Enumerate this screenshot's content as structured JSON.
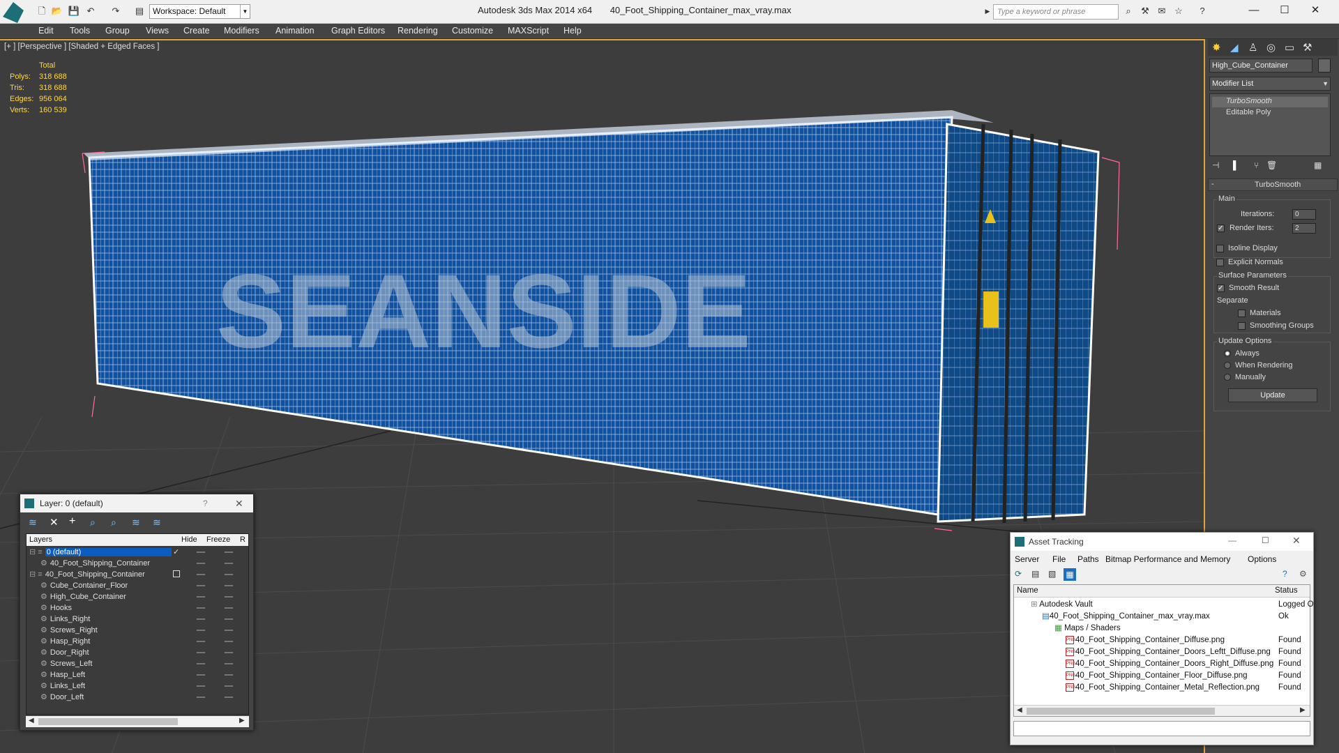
{
  "titlebar": {
    "app": "Autodesk 3ds Max  2014 x64",
    "file": "40_Foot_Shipping_Container_max_vray.max",
    "workspace": "Workspace: Default",
    "search_placeholder": "Type a keyword or phrase"
  },
  "menu": [
    "Edit",
    "Tools",
    "Group",
    "Views",
    "Create",
    "Modifiers",
    "Animation",
    "Graph Editors",
    "Rendering",
    "Customize",
    "MAXScript",
    "Help"
  ],
  "viewport": {
    "label": "[+ ] [Perspective ] [Shaded + Edged Faces ]",
    "stats": {
      "header": "Total",
      "rows": [
        {
          "label": "Polys:",
          "value": "318 688"
        },
        {
          "label": "Tris:",
          "value": "318 688"
        },
        {
          "label": "Edges:",
          "value": "956 064"
        },
        {
          "label": "Verts:",
          "value": "160 539"
        }
      ]
    }
  },
  "command_panel": {
    "object_name": "High_Cube_Container",
    "modifier_list": "Modifier List",
    "stack": [
      "TurboSmooth",
      "Editable Poly"
    ],
    "rollout_title": "TurboSmooth",
    "main": {
      "group": "Main",
      "iterations_label": "Iterations:",
      "iterations": "0",
      "render_iters_label": "Render Iters:",
      "render_iters": "2",
      "isoline": "Isoline Display",
      "explicit": "Explicit Normals"
    },
    "surface": {
      "group": "Surface Parameters",
      "smooth_result": "Smooth Result",
      "separate": "Separate",
      "materials": "Materials",
      "smoothing_groups": "Smoothing Groups"
    },
    "update": {
      "group": "Update Options",
      "always": "Always",
      "when_rendering": "When Rendering",
      "manually": "Manually",
      "button": "Update"
    }
  },
  "layer_window": {
    "title": "Layer: 0 (default)",
    "help": "?",
    "columns": [
      "Layers",
      "Hide",
      "Freeze",
      "R"
    ],
    "rows": [
      {
        "name": "0 (default)",
        "indent": 0,
        "selected": true
      },
      {
        "name": "40_Foot_Shipping_Container",
        "indent": 1
      },
      {
        "name": "40_Foot_Shipping_Container",
        "indent": 0
      },
      {
        "name": "Cube_Container_Floor",
        "indent": 1
      },
      {
        "name": "High_Cube_Container",
        "indent": 1
      },
      {
        "name": "Hooks",
        "indent": 1
      },
      {
        "name": "Links_Right",
        "indent": 1
      },
      {
        "name": "Screws_Right",
        "indent": 1
      },
      {
        "name": "Hasp_Right",
        "indent": 1
      },
      {
        "name": "Door_Right",
        "indent": 1
      },
      {
        "name": "Screws_Left",
        "indent": 1
      },
      {
        "name": "Hasp_Left",
        "indent": 1
      },
      {
        "name": "Links_Left",
        "indent": 1
      },
      {
        "name": "Door_Left",
        "indent": 1
      }
    ]
  },
  "asset_window": {
    "title": "Asset Tracking",
    "menu": [
      "Server",
      "File",
      "Paths",
      "Bitmap Performance and Memory",
      "Options"
    ],
    "columns": [
      "Name",
      "Status"
    ],
    "rows": [
      {
        "name": "Autodesk Vault",
        "status": "Logged O",
        "indent": 0
      },
      {
        "name": "40_Foot_Shipping_Container_max_vray.max",
        "status": "Ok",
        "indent": 1
      },
      {
        "name": "Maps / Shaders",
        "status": "",
        "indent": 2
      },
      {
        "name": "40_Foot_Shipping_Container_Diffuse.png",
        "status": "Found",
        "indent": 3
      },
      {
        "name": "40_Foot_Shipping_Container_Doors_Leftt_Diffuse.png",
        "status": "Found",
        "indent": 3
      },
      {
        "name": "40_Foot_Shipping_Container_Doors_Right_Diffuse.png",
        "status": "Found",
        "indent": 3
      },
      {
        "name": "40_Foot_Shipping_Container_Floor_Diffuse.png",
        "status": "Found",
        "indent": 3
      },
      {
        "name": "40_Foot_Shipping_Container_Metal_Reflection.png",
        "status": "Found",
        "indent": 3
      }
    ]
  },
  "colors": {
    "accent": "#e4a33c",
    "selection": "#0b5cc0",
    "container_blue": "#0d4a86",
    "stats_yellow": "#ffd84a"
  }
}
